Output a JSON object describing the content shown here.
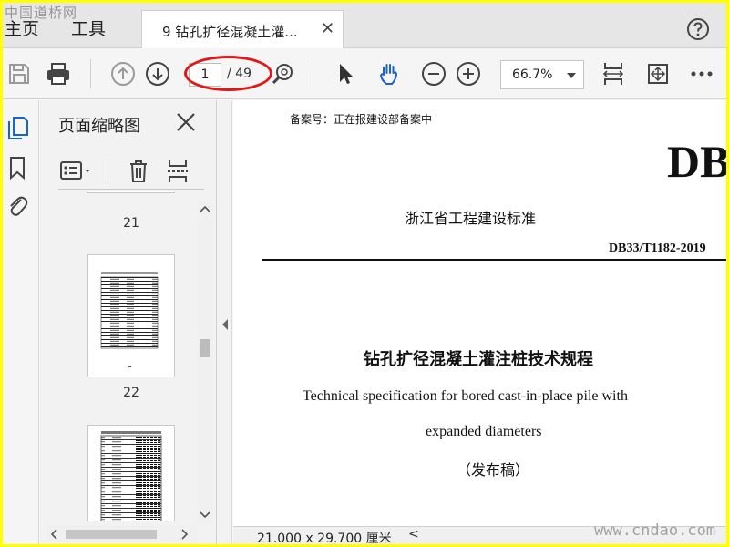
{
  "watermarks": {
    "top": "中国道桥网",
    "bottom": "www.cndao.com"
  },
  "menu": {
    "home": "主页",
    "tools": "工具"
  },
  "tab": {
    "title": "9 钻孔扩径混凝土灌...",
    "close": "✕"
  },
  "toolbar": {
    "page_current": "1",
    "page_total": "/ 49",
    "zoom": "66.7%"
  },
  "sidebar": {
    "title": "页面缩略图",
    "thumbnails": [
      {
        "page": "21"
      },
      {
        "page": "22"
      }
    ]
  },
  "document": {
    "record_note": "备案号：正在报建设部备案中",
    "db_mark": "DB",
    "province_std": "浙江省工程建设标准",
    "std_code": "DB33/T1182-2019",
    "title_cn": "钻孔扩径混凝土灌注桩技术规程",
    "title_en_1": "Technical specification for bored cast-in-place pile with",
    "title_en_2": "expanded diameters",
    "draft": "（发布稿）"
  },
  "status": {
    "page_size": "21.000 x 29.700 厘米",
    "scroll_left": "<"
  },
  "colors": {
    "annotation_ellipse": "#e01818",
    "page_frame": "#ffff00"
  }
}
